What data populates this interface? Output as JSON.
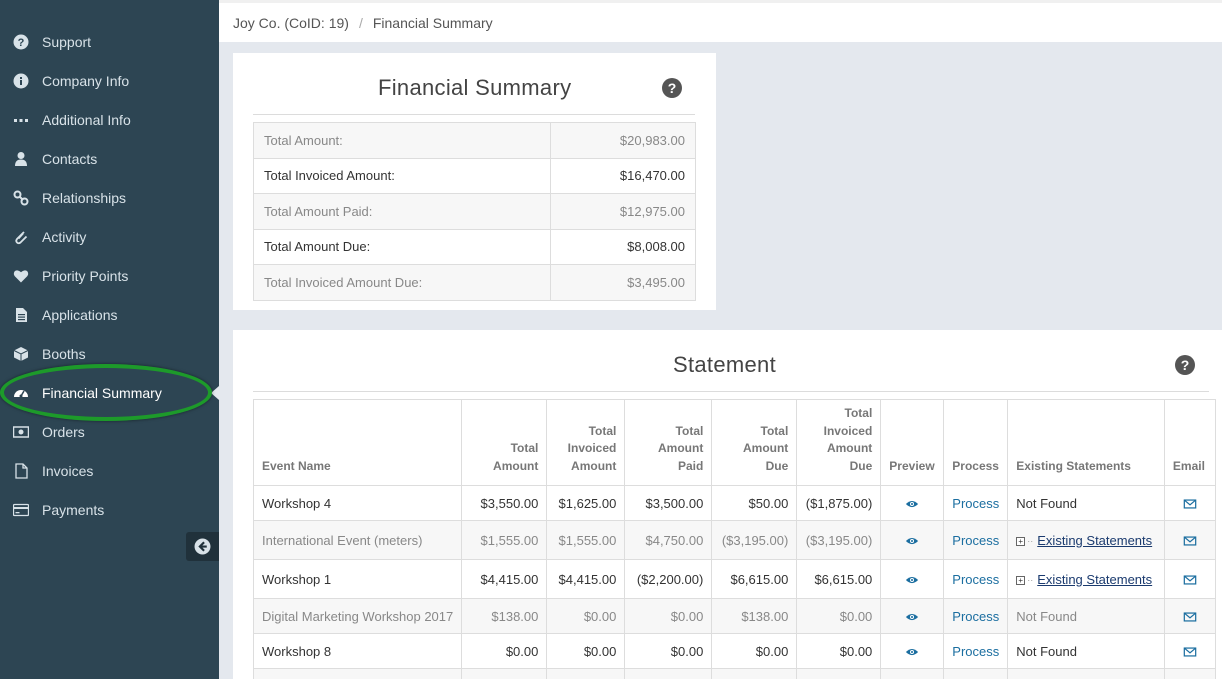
{
  "sidebar": {
    "items": [
      {
        "label": "Support",
        "icon": "question-circle-icon"
      },
      {
        "label": "Company Info",
        "icon": "info-circle-icon"
      },
      {
        "label": "Additional Info",
        "icon": "ellipsis-icon"
      },
      {
        "label": "Contacts",
        "icon": "user-icon"
      },
      {
        "label": "Relationships",
        "icon": "link-icon"
      },
      {
        "label": "Activity",
        "icon": "paperclip-icon"
      },
      {
        "label": "Priority Points",
        "icon": "heart-icon"
      },
      {
        "label": "Applications",
        "icon": "document-icon"
      },
      {
        "label": "Booths",
        "icon": "cube-icon"
      },
      {
        "label": "Financial Summary",
        "icon": "dashboard-icon"
      },
      {
        "label": "Orders",
        "icon": "money-icon"
      },
      {
        "label": "Invoices",
        "icon": "file-icon"
      },
      {
        "label": "Payments",
        "icon": "credit-card-icon"
      }
    ],
    "active_index": 9,
    "collapse_icon": "arrow-circle-left-icon"
  },
  "breadcrumb": {
    "company": "Joy Co. (CoID: 19)",
    "separator": "/",
    "current": "Financial Summary"
  },
  "summary": {
    "title": "Financial Summary",
    "help": "?",
    "rows": [
      {
        "label": "Total Amount:",
        "value": "$20,983.00"
      },
      {
        "label": "Total Invoiced Amount:",
        "value": "$16,470.00"
      },
      {
        "label": "Total Amount Paid:",
        "value": "$12,975.00"
      },
      {
        "label": "Total Amount Due:",
        "value": "$8,008.00"
      },
      {
        "label": "Total Invoiced Amount Due:",
        "value": "$3,495.00"
      }
    ]
  },
  "statement": {
    "title": "Statement",
    "help": "?",
    "headers": {
      "event_name": "Event Name",
      "total_amount": [
        "Total",
        "Amount"
      ],
      "total_invoiced_amount": [
        "Total",
        "Invoiced",
        "Amount"
      ],
      "total_amount_paid": [
        "Total",
        "Amount",
        "Paid"
      ],
      "total_amount_due": [
        "Total",
        "Amount",
        "Due"
      ],
      "total_invoiced_amount_due": [
        "Total",
        "Invoiced",
        "Amount",
        "Due"
      ],
      "preview": "Preview",
      "process": "Process",
      "existing_statements": "Existing Statements",
      "email": "Email"
    },
    "rows": [
      {
        "event": "Workshop 4",
        "total": "$3,550.00",
        "invoiced": "$1,625.00",
        "paid": "$3,500.00",
        "due": "$50.00",
        "invoiced_due": "($1,875.00)",
        "process": "Process",
        "existing": "Not Found",
        "existing_link": false
      },
      {
        "event": "International Event (meters)",
        "total": "$1,555.00",
        "invoiced": "$1,555.00",
        "paid": "$4,750.00",
        "due": "($3,195.00)",
        "invoiced_due": "($3,195.00)",
        "process": "Process",
        "existing": "Existing Statements",
        "existing_link": true
      },
      {
        "event": "Workshop 1",
        "total": "$4,415.00",
        "invoiced": "$4,415.00",
        "paid": "($2,200.00)",
        "due": "$6,615.00",
        "invoiced_due": "$6,615.00",
        "process": "Process",
        "existing": "Existing Statements",
        "existing_link": true
      },
      {
        "event": "Digital Marketing Workshop 2017",
        "total": "$138.00",
        "invoiced": "$0.00",
        "paid": "$0.00",
        "due": "$138.00",
        "invoiced_due": "$0.00",
        "process": "Process",
        "existing": "Not Found",
        "existing_link": false
      },
      {
        "event": "Workshop 8",
        "total": "$0.00",
        "invoiced": "$0.00",
        "paid": "$0.00",
        "due": "$0.00",
        "invoiced_due": "$0.00",
        "process": "Process",
        "existing": "Not Found",
        "existing_link": false
      }
    ]
  },
  "colors": {
    "sidebar_bg": "#2d4553",
    "highlight_ring": "#1d9a2a",
    "link": "#1b6ea0"
  }
}
